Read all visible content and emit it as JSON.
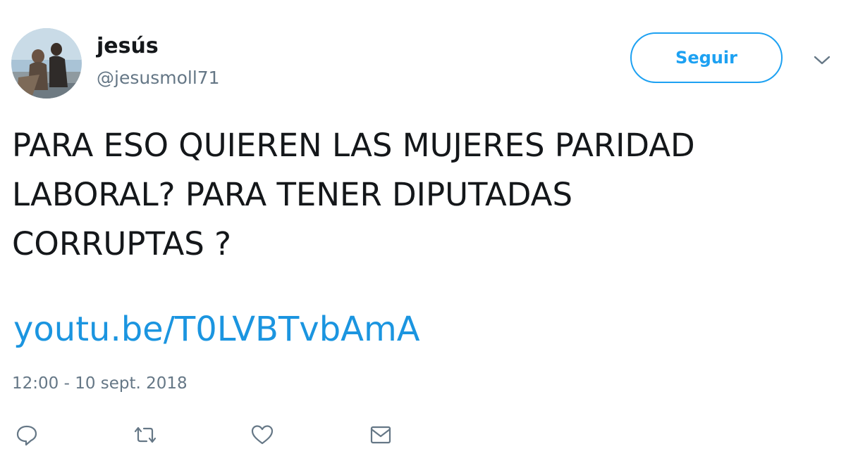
{
  "author": {
    "name": "jesús",
    "handle": "@jesusmoll71",
    "avatar_icon": "profile-photo"
  },
  "follow_button": {
    "label": "Seguir"
  },
  "tweet": {
    "text_lines": [
      "PARA ESO QUIEREN LAS MUJERES PARIDAD",
      "LABORAL? PARA TENER DIPUTADAS",
      "CORRUPTAS ?"
    ],
    "link": "youtu.be/T0LVBTvbAmA",
    "timestamp": "12:00 - 10 sept. 2018"
  },
  "actions": [
    {
      "icon": "reply-icon"
    },
    {
      "icon": "retweet-icon"
    },
    {
      "icon": "like-icon"
    },
    {
      "icon": "message-icon"
    }
  ],
  "colors": {
    "accent": "#1da1f2",
    "link": "#1b95e0",
    "text": "#14171a",
    "muted": "#657786"
  }
}
